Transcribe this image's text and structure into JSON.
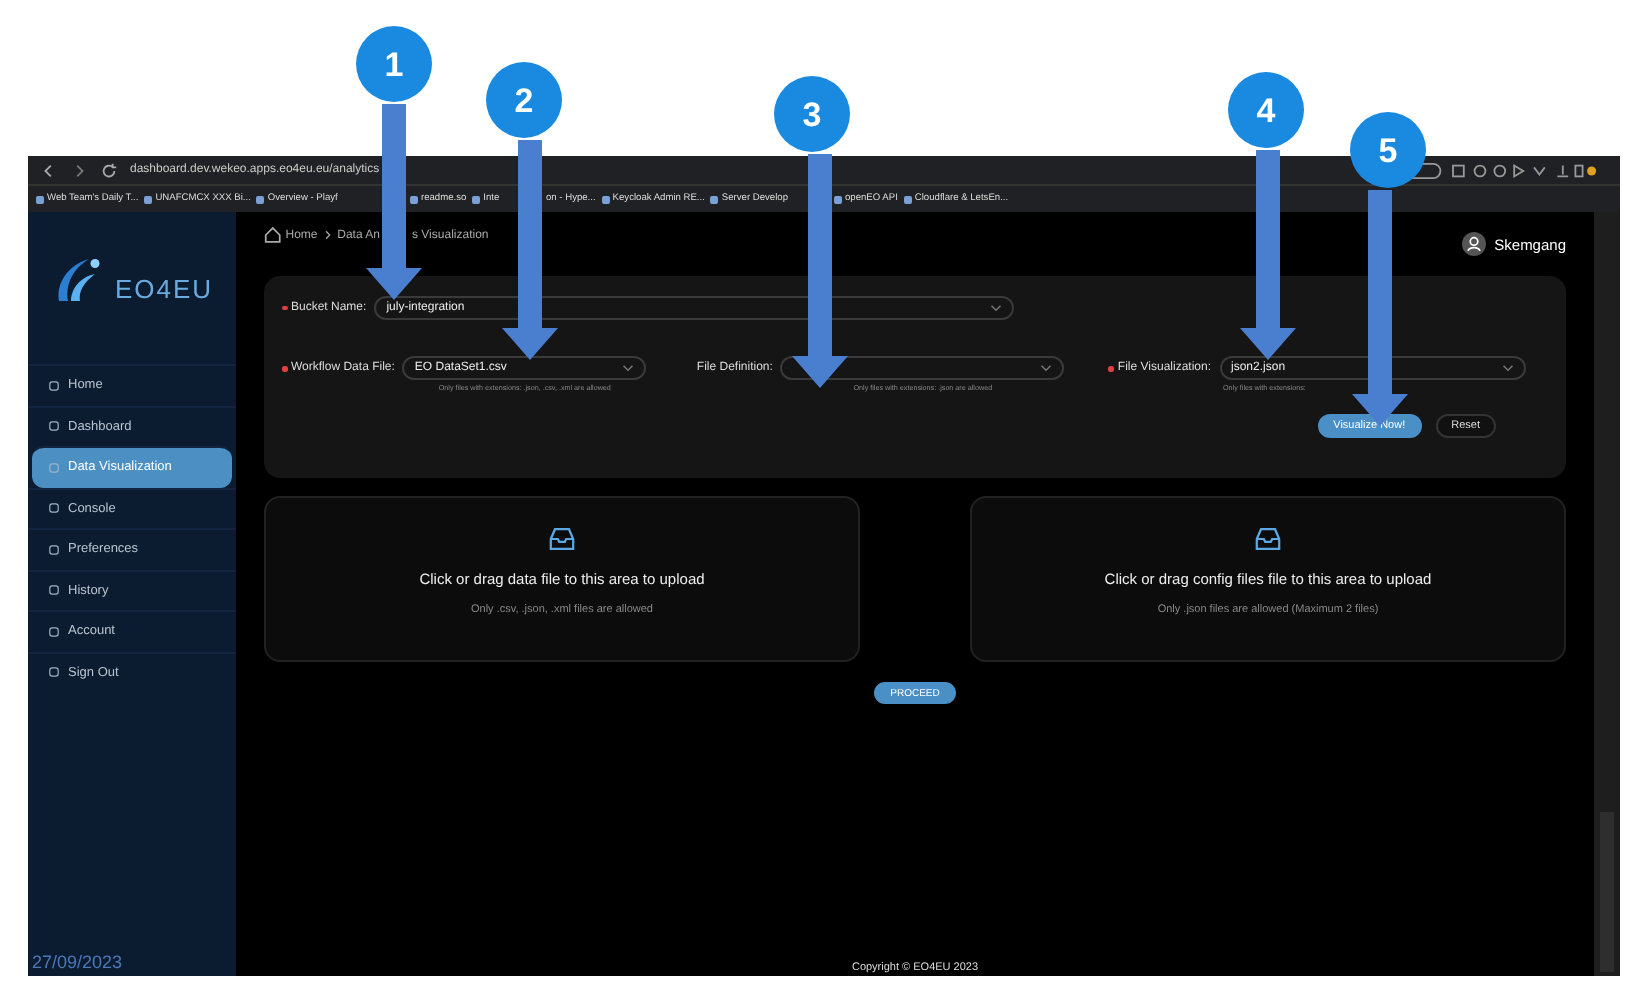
{
  "browser": {
    "url": "dashboard.dev.wekeo.apps.eo4eu.eu/analytics",
    "bookmarks": [
      {
        "parts": [
          "Web Team's Daily T..."
        ]
      },
      {
        "parts": [
          "UNAFCMCX XXX Bi..."
        ]
      },
      {
        "parts": [
          "Overview - Playf"
        ]
      },
      {
        "parts": [
          "readme.so"
        ]
      },
      {
        "parts": [
          "Inte",
          "on - Hype..."
        ]
      },
      {
        "parts": [
          "Keycloak Admin RE..."
        ]
      },
      {
        "parts": [
          "Server Develop"
        ]
      },
      {
        "parts": [
          "openEO API"
        ]
      },
      {
        "parts": [
          "Cloudflare & LetsEn..."
        ]
      }
    ]
  },
  "sidebar": {
    "logo": "EO4EU",
    "items": [
      {
        "label": "Home",
        "selected": false
      },
      {
        "label": "Dashboard",
        "selected": false
      },
      {
        "label": "Data Visualization",
        "selected": true
      },
      {
        "label": "Console",
        "selected": false
      },
      {
        "label": "Preferences",
        "selected": false
      },
      {
        "label": "History",
        "selected": false
      },
      {
        "label": "Account",
        "selected": false
      },
      {
        "label": "Sign Out",
        "selected": false
      }
    ]
  },
  "breadcrumb": {
    "home": "Home",
    "current_parts": [
      "Data An",
      "s Visualization"
    ]
  },
  "user": "Skemgang",
  "form": {
    "bucket": {
      "label": "Bucket Name:",
      "required": true,
      "value": "july-integration"
    },
    "fields": [
      {
        "label": "Workflow Data File:",
        "required": true,
        "value": "EO DataSet1.csv",
        "hint": "Only files with extensions: .json, .csv, .xml are allowed"
      },
      {
        "label": "File Definition:",
        "required": false,
        "hint": "Only files with extensions: .json are allowed"
      },
      {
        "label": "File Visualization:",
        "required": true,
        "value": "json2.json",
        "hint": "Only files with extensions:"
      }
    ],
    "buttons": [
      {
        "label": "Visualize Now!",
        "kind": "primary"
      },
      {
        "label": "Reset",
        "kind": "default"
      }
    ]
  },
  "uploads": [
    {
      "title": "Click or drag data file to this area to upload",
      "hint": "Only .csv, .json, .xml files are allowed"
    },
    {
      "title": "Click or drag config files file to this area to upload",
      "hint": "Only .json files are allowed (Maximum 2 files)"
    }
  ],
  "proceed": "PROCEED",
  "footer": "Copyright © EO4EU 2023",
  "date": "27/09/2023",
  "callouts": [
    {
      "number": "1"
    },
    {
      "number": "2"
    },
    {
      "number": "3"
    },
    {
      "number": "4"
    },
    {
      "number": "5"
    }
  ]
}
